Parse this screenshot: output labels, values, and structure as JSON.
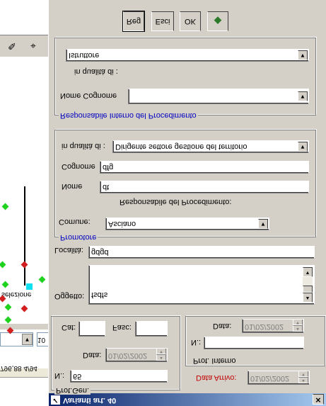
{
  "window": {
    "title": "Varianti art. 40",
    "close": "✕"
  },
  "background": {
    "top_text": "796,88  4/94",
    "input_value": "10",
    "label": "selezione"
  },
  "prot_gen": {
    "legend": "Prot.Gen.",
    "num_label": "N.:",
    "num_value": "65",
    "date_label": "Data:",
    "date_value": "01/02/2002",
    "cat_label": "Cat:",
    "cat_value": "",
    "fasc_label": "Fasc:",
    "fasc_value": ""
  },
  "prot_interno": {
    "legend": "Prot. Interno",
    "num_label": "N.:",
    "num_value": "",
    "date_label": "Data:",
    "date_value": "01/02/2002"
  },
  "data_arrivo": {
    "label": "Data Arrivo:",
    "value": "01/02/2002"
  },
  "oggetto": {
    "label": "Oggetto:",
    "value": "fsdfs"
  },
  "localita": {
    "label": "Località:",
    "value": "gdgd"
  },
  "promotore": {
    "legend": "Promotore",
    "comune_label": "Comune:",
    "comune_value": "Asciano"
  },
  "responsabile_proc": {
    "heading": "Responsabile del Procedimento:",
    "nome_label": "Nome",
    "nome_value": "dt",
    "cognome_label": "Cognome",
    "cognome_value": "dfg",
    "qualita_label": "in qualità di :",
    "qualita_value": "Dirigente settore gestione del territorio"
  },
  "responsabile_interno": {
    "legend": "Responsabile Interno del Procedimento",
    "nome_cognome_label": "Nome   Cognome",
    "nome_cognome_value": "",
    "qualita_label": "in qualità di :",
    "qualita_value": "Istruttore"
  },
  "buttons": {
    "ok": "OK",
    "esci": "Esci",
    "reg": "Reg"
  },
  "colors": {
    "title_from": "#0a246a",
    "title_to": "#a6caf0",
    "legend_blue": "#0000c0",
    "label_red": "#c00000"
  }
}
